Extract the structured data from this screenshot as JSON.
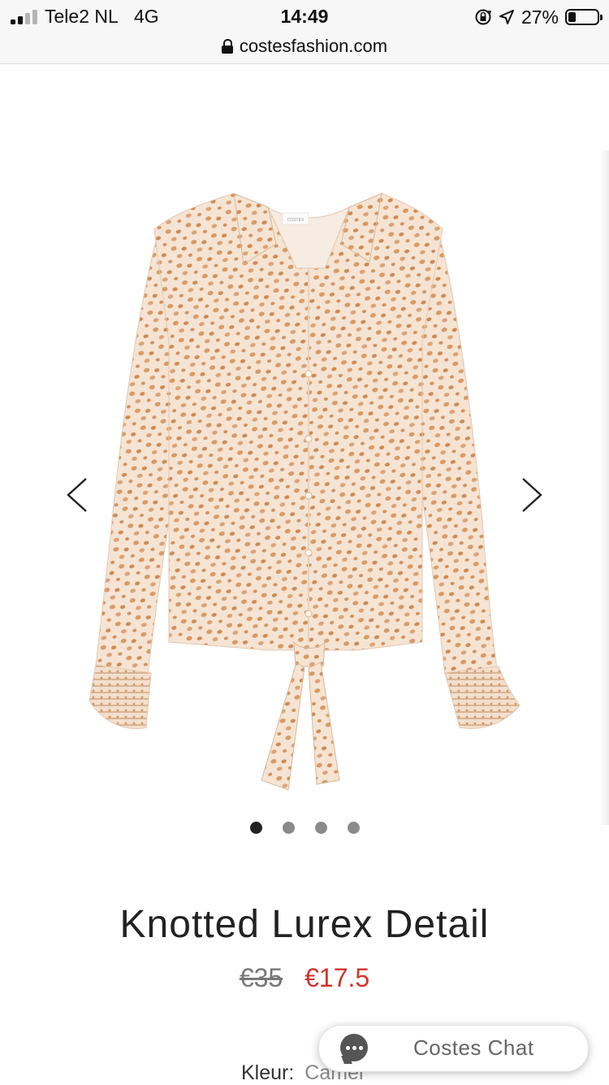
{
  "status_bar": {
    "carrier": "Tele2 NL",
    "network": "4G",
    "time": "14:49",
    "battery_percent": "27%",
    "battery_level": 0.27
  },
  "browser": {
    "url": "costesfashion.com"
  },
  "product": {
    "title": "Knotted Lurex Detail",
    "old_price": "€35",
    "new_price": "€17.5",
    "color_label": "Kleur:",
    "color_value": "Camel",
    "image_label": "COSTES",
    "image_count": 4,
    "active_image": 1
  },
  "chat": {
    "label": "Costes Chat"
  },
  "colors": {
    "sale_price": "#d0342c",
    "blouse_base": "#f5e3d2",
    "dot_pattern": "#d8955f"
  },
  "icons": {
    "prev": "chevron-left-icon",
    "next": "chevron-right-icon",
    "chat": "chat-bubble-icon",
    "lock": "lock-icon"
  }
}
